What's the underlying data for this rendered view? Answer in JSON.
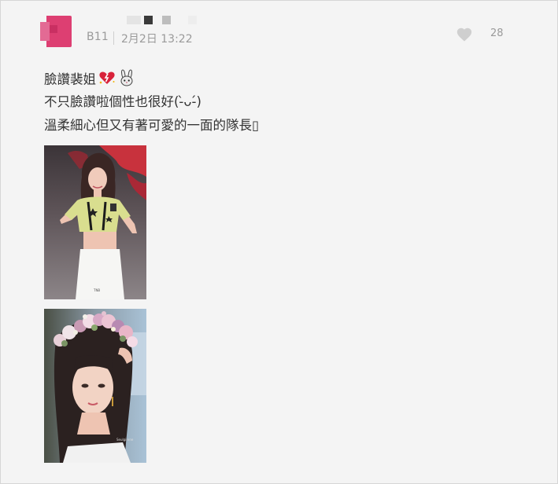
{
  "post": {
    "author_avatar_icon": "avatar",
    "floor": "B11",
    "date": "2月2日 13:22",
    "like_icon": "heart-icon",
    "like_count": "28"
  },
  "content": {
    "line1": "臉讚裴姐",
    "line1_emojis": [
      "sparkling-heart-icon",
      "rabbit-icon"
    ],
    "line2": "不只臉讚啦個性也很好(-̀ᴗ-́)",
    "line3": "溫柔細心但又有著可愛的一面的隊長▯"
  },
  "images": [
    {
      "name": "stage-photo"
    },
    {
      "name": "flower-crown-photo"
    }
  ],
  "colors": {
    "background": "#f4f4f4",
    "text": "#333333",
    "meta": "#9a9a9a",
    "avatar": "#dd3f72"
  }
}
